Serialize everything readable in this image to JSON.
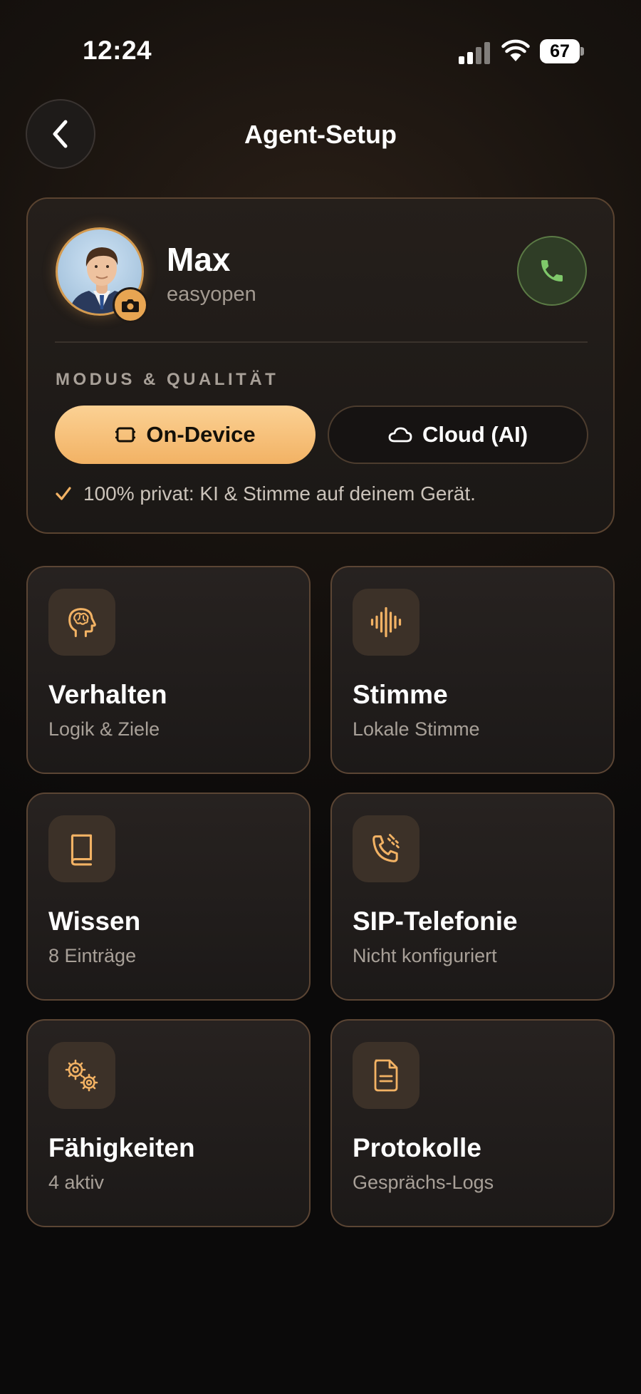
{
  "status_bar": {
    "time": "12:24",
    "battery": "67"
  },
  "header": {
    "title": "Agent-Setup"
  },
  "profile": {
    "name": "Max",
    "subtitle": "easyopen",
    "section_label": "MODUS & QUALITÄT",
    "modes": [
      {
        "label": "On-Device",
        "selected": true
      },
      {
        "label": "Cloud (AI)",
        "selected": false
      }
    ],
    "privacy_note": "100% privat: KI & Stimme auf deinem Gerät."
  },
  "tiles": [
    {
      "icon": "brain-head-icon",
      "title": "Verhalten",
      "subtitle": "Logik & Ziele"
    },
    {
      "icon": "sound-wave-icon",
      "title": "Stimme",
      "subtitle": "Lokale Stimme"
    },
    {
      "icon": "book-icon",
      "title": "Wissen",
      "subtitle": "8 Einträge"
    },
    {
      "icon": "phone-signal-icon",
      "title": "SIP-Telefonie",
      "subtitle": "Nicht konfiguriert"
    },
    {
      "icon": "gears-icon",
      "title": "Fähigkeiten",
      "subtitle": "4 aktiv"
    },
    {
      "icon": "document-icon",
      "title": "Protokolle",
      "subtitle": "Gesprächs-Logs"
    }
  ],
  "colors": {
    "accent": "#f2b264",
    "call_green": "#7fc86a",
    "card_border": "#5b4534"
  }
}
